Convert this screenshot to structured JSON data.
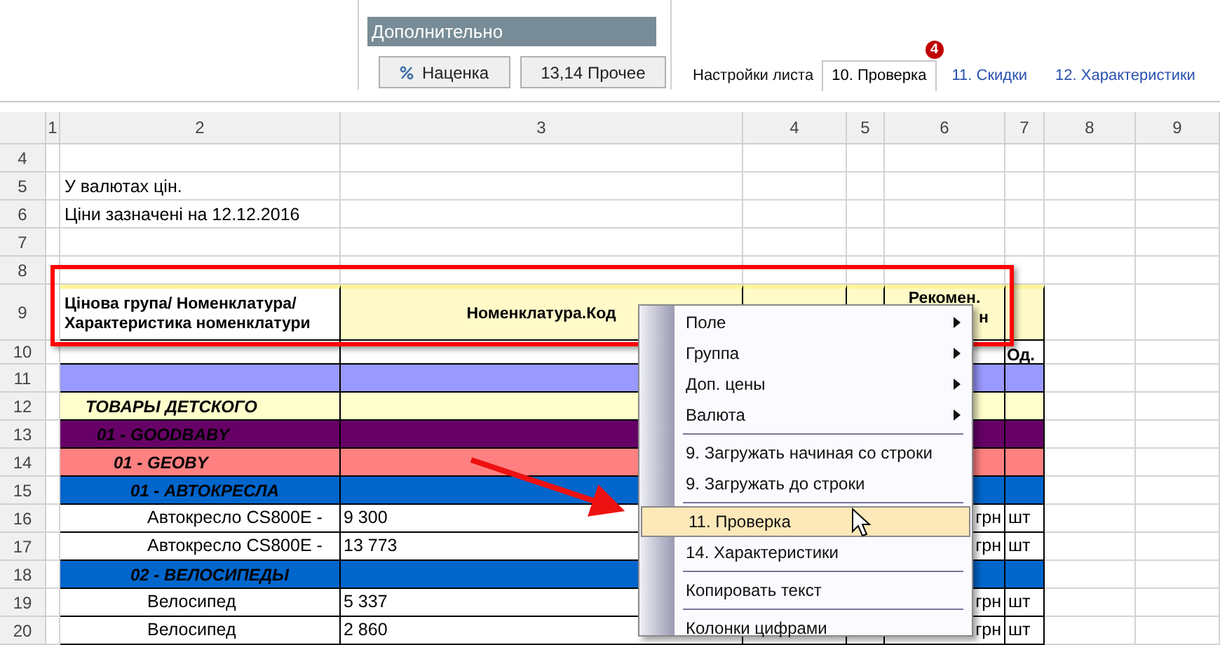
{
  "toolbar": {
    "group_title": "Дополнительно",
    "buttons": [
      {
        "label": "Наценка",
        "kind": "percent"
      },
      {
        "label": "13,14 Прочее",
        "kind": "plain"
      }
    ],
    "tabs": [
      {
        "label": "Настройки листа",
        "selected": false,
        "kind": "plain"
      },
      {
        "label": "10. Проверка",
        "selected": true,
        "kind": "plain",
        "badge": "4"
      },
      {
        "label": "11. Скидки",
        "selected": false,
        "kind": "link"
      },
      {
        "label": "12. Характеристики",
        "selected": false,
        "kind": "link"
      }
    ]
  },
  "sheet": {
    "columns": [
      "1",
      "2",
      "3",
      "4",
      "5",
      "6",
      "7",
      "8",
      "9"
    ],
    "rows": [
      {
        "row": "4"
      },
      {
        "row": "5",
        "col_2": "У валютах цін."
      },
      {
        "row": "6",
        "col_2": "Ціни зазначені на 12.12.2016"
      },
      {
        "row": "7"
      },
      {
        "row": "8"
      },
      {
        "row": "9",
        "kind": "header",
        "col_2": "Цінова група/ Номенклатура/ Характеристика номенклатури",
        "col_3": "Номенклатура.Код",
        "col_6": "Рекомен.",
        "col_6_end": "н"
      },
      {
        "row": "10",
        "kind": "subheader",
        "col_7": "Од."
      },
      {
        "row": "11",
        "kind": "band",
        "color": "#9999ff"
      }
    ],
    "tree": [
      {
        "row": "12",
        "text": "ТОВАРЫ ДЕТСКОГО",
        "color": "#ffffcc",
        "children": [
          {
            "row": "13",
            "text": "01 - GOODBABY",
            "color": "#660066",
            "children": [
              {
                "row": "14",
                "text": "01 - GEOBY",
                "color": "#ff8080",
                "children": [
                  {
                    "row": "15",
                    "text": "01 - АВТОКРЕСЛА",
                    "color": "#0066cc",
                    "children": [
                      {
                        "row": "16",
                        "text": "Автокресло CS800E -",
                        "col_3": "9 300",
                        "col_6": "грн",
                        "col_7": "шт"
                      },
                      {
                        "row": "17",
                        "text": "Автокресло CS800E -",
                        "col_3": "13 773",
                        "col_6": "грн",
                        "col_7": "шт"
                      }
                    ]
                  },
                  {
                    "row": "18",
                    "text": "02 - ВЕЛОСИПЕДЫ",
                    "color": "#0066cc",
                    "children": [
                      {
                        "row": "19",
                        "text": "Велосипед",
                        "col_3": "5 337",
                        "col_6": "грн",
                        "col_7": "шт"
                      },
                      {
                        "row": "20",
                        "text": "Велосипед",
                        "col_3": "2 860",
                        "col_6": "грн",
                        "col_7": "шт"
                      }
                    ]
                  }
                ]
              }
            ]
          }
        ]
      }
    ]
  },
  "context_menu": [
    {
      "kind": "item",
      "label": "Поле",
      "submenu": true,
      "selected": false
    },
    {
      "kind": "item",
      "label": "Группа",
      "submenu": true,
      "selected": false
    },
    {
      "kind": "item",
      "label": "Доп. цены",
      "submenu": true,
      "selected": false
    },
    {
      "kind": "item",
      "label": "Валюта",
      "submenu": true,
      "selected": false
    },
    {
      "kind": "separator"
    },
    {
      "kind": "item",
      "label": "9. Загружать начиная со строки",
      "submenu": false,
      "selected": false
    },
    {
      "kind": "item",
      "label": "9. Загружать до строки",
      "submenu": false,
      "selected": false
    },
    {
      "kind": "separator"
    },
    {
      "kind": "item",
      "label": "11. Проверка",
      "submenu": false,
      "selected": true
    },
    {
      "kind": "item",
      "label": "14. Характеристики",
      "submenu": false,
      "selected": false
    },
    {
      "kind": "separator"
    },
    {
      "kind": "item",
      "label": "Копировать текст",
      "submenu": false,
      "selected": false
    },
    {
      "kind": "separator"
    },
    {
      "kind": "item",
      "label": "Колонки цифрами",
      "submenu": false,
      "selected": false
    }
  ]
}
